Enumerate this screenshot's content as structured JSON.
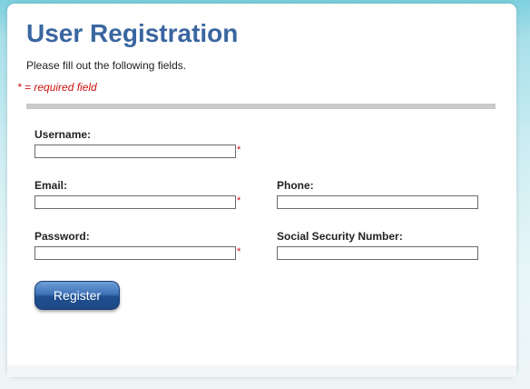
{
  "page": {
    "title": "User Registration",
    "intro": "Please fill out the following fields.",
    "required_note": "* = required field"
  },
  "form": {
    "required_marker": "*",
    "username": {
      "label": "Username:",
      "value": "",
      "required": true
    },
    "email": {
      "label": "Email:",
      "value": "",
      "required": true
    },
    "phone": {
      "label": "Phone:",
      "value": "",
      "required": false
    },
    "password": {
      "label": "Password:",
      "value": "",
      "required": true
    },
    "ssn": {
      "label": "Social Security Number:",
      "value": "",
      "required": false
    },
    "register_label": "Register"
  },
  "colors": {
    "title": "#3a66a0",
    "required": "#cc1111",
    "button": "#2a5b9c",
    "divider": "#c9c9c9"
  }
}
